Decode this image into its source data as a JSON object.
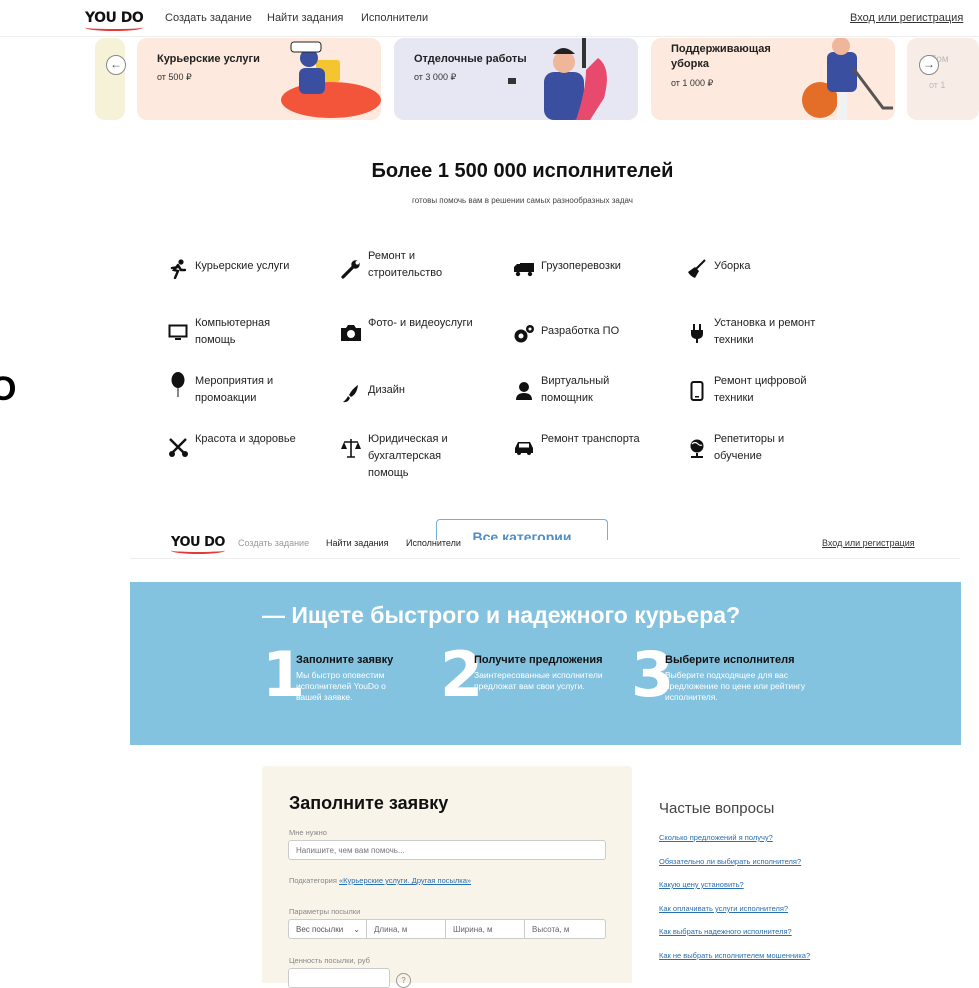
{
  "header": {
    "logo": "YOU DO",
    "nav": [
      "Создать задание",
      "Найти задания",
      "Исполнители"
    ],
    "login": "Вход или регистрация"
  },
  "carousel": {
    "cards": [
      {
        "title": "Курьерские услуги",
        "price": "от 500 ₽",
        "bg": "#fde9dd"
      },
      {
        "title": "Отделочные работы",
        "price": "от 3 000 ₽",
        "bg": "#e7e6f3"
      },
      {
        "title": "Поддерживающая уборка",
        "price": "от 1 000 ₽",
        "bg": "#fde9dd"
      }
    ],
    "partial_card": {
      "title": "Пом",
      "price": "от 1"
    }
  },
  "hero": {
    "title": "Более 1 500 000 исполнителей",
    "subtitle": "готовы помочь вам в решении самых разнообразных задач"
  },
  "categories": [
    {
      "label": "Курьерские услуги",
      "icon": "courier-icon"
    },
    {
      "label": "Ремонт и строительство",
      "icon": "wrench-icon"
    },
    {
      "label": "Грузоперевозки",
      "icon": "truck-icon"
    },
    {
      "label": "Уборка",
      "icon": "broom-icon"
    },
    {
      "label": "Компьютерная помощь",
      "icon": "monitor-icon"
    },
    {
      "label": "Фото- и видеоуслуги",
      "icon": "camera-icon"
    },
    {
      "label": "Разработка ПО",
      "icon": "gears-icon"
    },
    {
      "label": "Установка и ремонт техники",
      "icon": "plug-icon"
    },
    {
      "label": "Мероприятия и промоакции",
      "icon": "balloon-icon"
    },
    {
      "label": "Дизайн",
      "icon": "brush-icon"
    },
    {
      "label": "Виртуальный помощник",
      "icon": "person-icon"
    },
    {
      "label": "Ремонт цифровой техники",
      "icon": "phone-icon"
    },
    {
      "label": "Красота и здоровье",
      "icon": "scissors-icon"
    },
    {
      "label": "Юридическая и бухгалтерская помощь",
      "icon": "scales-icon"
    },
    {
      "label": "Ремонт транспорта",
      "icon": "car-icon"
    },
    {
      "label": "Репетиторы и обучение",
      "icon": "globe-icon"
    }
  ],
  "all_categories_button": "Все категории",
  "edge_glyph": "O",
  "header2": {
    "logo": "YOU DO",
    "nav": [
      "Создать задание",
      "Найти задания",
      "Исполнители"
    ],
    "login": "Вход или регистрация"
  },
  "banner": {
    "title": "— Ищете быстрого и надежного курьера?",
    "bg": "#84c3df",
    "steps": [
      {
        "num": "1",
        "title": "Заполните заявку",
        "desc": "Мы быстро оповестим исполнителей YouDo о вашей заявке."
      },
      {
        "num": "2",
        "title": "Получите предложения",
        "desc": "Заинтересованные исполнители предложат вам свои услуги."
      },
      {
        "num": "3",
        "title": "Выберите исполнителя",
        "desc": "Выберите подходящее для вас предложение по цене или рейтингу исполнителя."
      }
    ]
  },
  "form": {
    "title": "Заполните заявку",
    "need_label": "Мне нужно",
    "need_placeholder": "Напишите, чем вам помочь...",
    "subcategory_prefix": "Подкатегория",
    "subcategory_value": "«Курьерские услуги. Другая посылка»",
    "params_label": "Параметры посылки",
    "weight": "Вес посылки",
    "length": "Длина, м",
    "width": "Ширина, м",
    "height": "Высота, м",
    "value_label": "Ценность посылки, руб",
    "help": "?"
  },
  "faq": {
    "title": "Частые вопросы",
    "items": [
      "Сколько предложений я получу?",
      "Обязательно ли выбирать исполнителя?",
      "Какую цену установить?",
      "Как оплачивать услуги исполнителя?",
      "Как выбрать надежного исполнителя?",
      "Как не выбрать исполнителем мошенника?"
    ]
  }
}
